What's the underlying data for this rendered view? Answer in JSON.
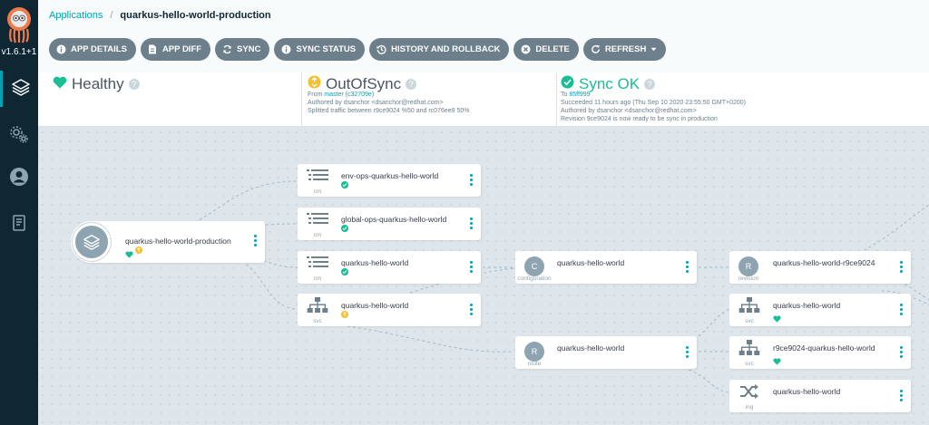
{
  "sidebar": {
    "version": "v1.6.1+1",
    "items": [
      {
        "name": "applications",
        "icon": "layers-icon",
        "active": true
      },
      {
        "name": "settings",
        "icon": "gears-icon",
        "active": false
      },
      {
        "name": "user-info",
        "icon": "user-icon",
        "active": false
      },
      {
        "name": "docs",
        "icon": "book-icon",
        "active": false
      }
    ]
  },
  "breadcrumb": {
    "root": "Applications",
    "separator": "/",
    "current": "quarkus-hello-world-production"
  },
  "toolbar": {
    "app_details": "APP DETAILS",
    "app_diff": "APP DIFF",
    "sync": "SYNC",
    "sync_status": "SYNC STATUS",
    "history": "HISTORY AND ROLLBACK",
    "delete": "DELETE",
    "refresh": "REFRESH"
  },
  "status": {
    "health": {
      "label": "Healthy"
    },
    "sync": {
      "label": "OutOfSync",
      "from_prefix": "From",
      "from_link": "master (c32709e)",
      "author": "Authored by dsanchor <dsanchor@redhat.com>",
      "message": "Splitted traffic between r9ce9024 %50 and rc076ee9 50%"
    },
    "operation": {
      "label": "Sync OK",
      "to_prefix": "To",
      "to_link": "85ff999",
      "succeeded": "Succeeded 11 hours ago (Thu Sep 10 2020 23:55:50 GMT+0200)",
      "author": "Authored by dsanchor <dsanchor@redhat.com>",
      "message": "Revision 9ce9024 is now ready to be sync in production"
    }
  },
  "graph": {
    "root": {
      "name": "quarkus-hello-world-production"
    },
    "nodes": {
      "cm1": {
        "name": "env-ops-quarkus-hello-world",
        "kind": "cm"
      },
      "cm2": {
        "name": "global-ops-quarkus-hello-world",
        "kind": "cm"
      },
      "cm3": {
        "name": "quarkus-hello-world",
        "kind": "cm"
      },
      "svc1": {
        "name": "quarkus-hello-world",
        "kind": "svc"
      },
      "config": {
        "name": "quarkus-hello-world",
        "kind": "configuration",
        "letter": "C"
      },
      "route": {
        "name": "quarkus-hello-world",
        "kind": "route",
        "letter": "R"
      },
      "revision": {
        "name": "quarkus-hello-world-r9ce9024",
        "kind": "revision",
        "letter": "R"
      },
      "svc2": {
        "name": "quarkus-hello-world",
        "kind": "svc"
      },
      "svc3": {
        "name": "r9ce9024-quarkus-hello-world",
        "kind": "svc"
      },
      "ing": {
        "name": "quarkus-hello-world",
        "kind": "ing"
      }
    }
  },
  "colors": {
    "accent": "#00a2b3",
    "healthy": "#18be94",
    "warning": "#f4c030",
    "sidebar": "#0f2733",
    "button": "#6d7f8b"
  }
}
